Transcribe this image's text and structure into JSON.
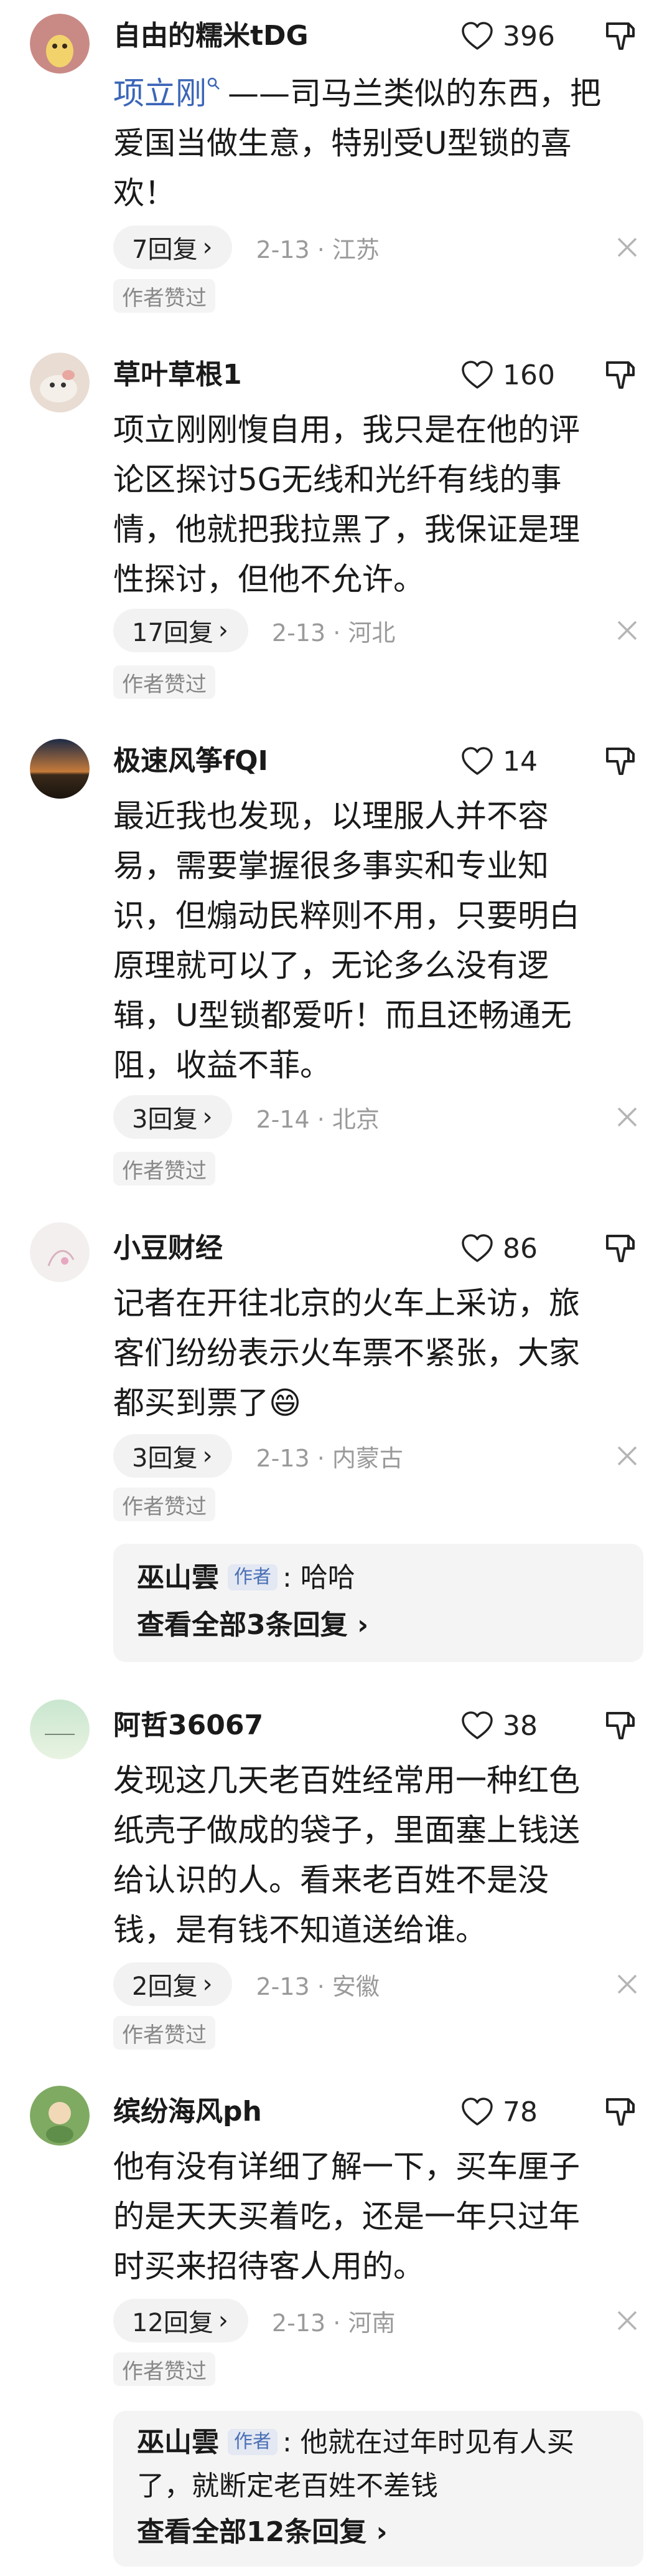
{
  "comments": [
    {
      "name": "自由的糯米tDG",
      "likes": "396",
      "mention": "项立刚",
      "lines": [
        "——司马兰类似的东西，把",
        "爱国当做生意，特别受U型锁的喜",
        "欢！"
      ],
      "replies": "7回复",
      "time": "2-13 · 江苏",
      "author_liked": "作者赞过"
    },
    {
      "name": "草叶草根1",
      "likes": "160",
      "lines": [
        "项立刚刚愎自用，我只是在他的评",
        "论区探讨5G无线和光纤有线的事",
        "情，他就把我拉黑了，我保证是理",
        "性探讨，但他不允许。"
      ],
      "replies": "17回复",
      "time": "2-13 · 河北",
      "author_liked": "作者赞过"
    },
    {
      "name": "极速风筝fQI",
      "likes": "14",
      "lines": [
        "最近我也发现，以理服人并不容",
        "易，需要掌握很多事实和专业知",
        "识，但煽动民粹则不用，只要明白",
        "原理就可以了，无论多么没有逻",
        "辑，U型锁都爱听！而且还畅通无",
        "阻，收益不菲。"
      ],
      "replies": "3回复",
      "time": "2-14 · 北京",
      "author_liked": "作者赞过"
    },
    {
      "name": "小豆财经",
      "likes": "86",
      "lines": [
        "记者在开往北京的火车上采访，旅",
        "客们纷纷表示火车票不紧张，大家",
        "都买到票了😄"
      ],
      "replies": "3回复",
      "time": "2-13 · 内蒙古",
      "author_liked": "作者赞过",
      "reply_preview": {
        "name": "巫山雲",
        "tag": "作者",
        "lines": [
          ": 哈哈"
        ],
        "view_all": "查看全部3条回复"
      }
    },
    {
      "name": "阿哲36067",
      "likes": "38",
      "lines": [
        "发现这几天老百姓经常用一种红色",
        "纸壳子做成的袋子，里面塞上钱送",
        "给认识的人。看来老百姓不是没",
        "钱，是有钱不知道送给谁。"
      ],
      "replies": "2回复",
      "time": "2-13 · 安徽",
      "author_liked": "作者赞过"
    },
    {
      "name": "缤纷海风ph",
      "likes": "78",
      "lines": [
        "他有没有详细了解一下，买车厘子",
        "的是天天买着吃，还是一年只过年",
        "时买来招待客人用的。"
      ],
      "replies": "12回复",
      "time": "2-13 · 河南",
      "author_liked": "作者赞过",
      "reply_preview": {
        "name": "巫山雲",
        "tag": "作者",
        "lines": [
          ": 他就在过年时见有人买",
          "了，就断定老百姓不差钱"
        ],
        "view_all": "查看全部12条回复"
      }
    }
  ],
  "icons": {
    "like": "heart-outline-icon",
    "dislike": "thumbs-down-icon",
    "close": "close-icon",
    "chevron": "chevron-right-icon",
    "search": "search-mini-icon"
  },
  "colors": {
    "link": "#3b66b8",
    "meta_gray": "#9a9a9a",
    "pill_bg": "#f2f2f2"
  }
}
